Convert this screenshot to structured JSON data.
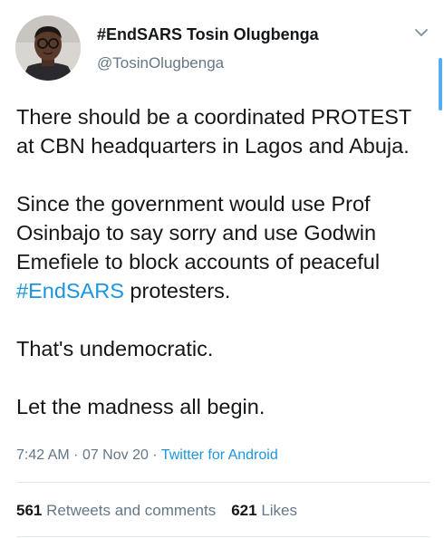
{
  "author": {
    "display_name": "#EndSARS Tosin Olugbenga",
    "handle": "@TosinOlugbenga"
  },
  "tweet": {
    "para1": "There should be a coordinated PROTEST at CBN headquarters in Lagos and Abuja.",
    "para2_before": "Since the government would use Prof Osinbajo to say sorry and use Godwin Emefiele to block accounts of peaceful ",
    "para2_hashtag": "#EndSARS",
    "para2_after": " protesters.",
    "para3": "That's undemocratic.",
    "para4": "Let the madness all begin."
  },
  "meta": {
    "time": "7:42 AM",
    "date": "07 Nov 20",
    "separator": "·",
    "source": "Twitter for Android"
  },
  "stats": {
    "retweets_count": "561",
    "retweets_label": "Retweets and comments",
    "likes_count": "621",
    "likes_label": "Likes"
  },
  "icons": {
    "chevron": "chevron-down-icon",
    "avatar": "avatar"
  },
  "colors": {
    "link": "#1b95e0",
    "secondary_text": "#657786",
    "primary_text": "#14171a",
    "divider": "#e1e8ed",
    "scrollbar": "#55aef2"
  }
}
